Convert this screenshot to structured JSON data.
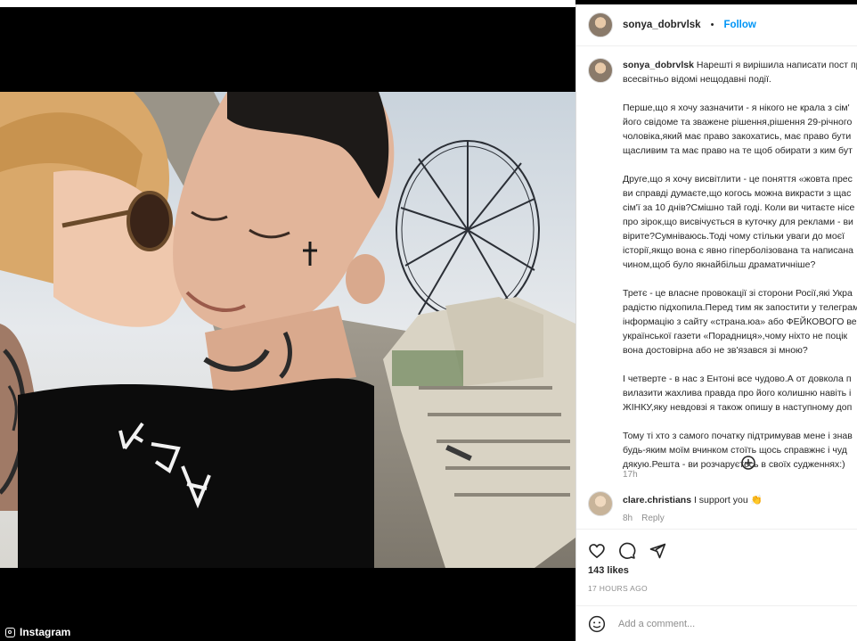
{
  "post": {
    "username": "sonya_dobrvlsk",
    "follow_label": "Follow",
    "caption_intro": "Нарешті я вирішила написати пост пр",
    "caption_lines": [
      "всесвітньо відомі нещодавні події.",
      "",
      "Перше,що я хочу зазначити - я нікого не крала з сім'",
      "його свідоме та зважене рішення,рішення 29-річного",
      "чоловіка,який має право закохатись, має право бути",
      "щасливим та має право на те щоб обирати з ким бут",
      "",
      "Друге,що я хочу висвітлити - це поняття «жовта прес",
      "ви справді думаєте,що когось можна викрасти з щас",
      "сім'ї за 10 днів?Смішно тай годі. Коли ви читаєте нісе",
      "про зірок,що висвічується в куточку для реклами - ви",
      "вірите?Сумніваюсь.Тоді чому стільки уваги до моєї",
      "історії,якщо вона є явно гіперболізована та написана",
      "чином,щоб було якнайбільш драматичніше?",
      "",
      "Третє - це власне провокації зі сторони Росії,які Укра",
      "радістю підхопила.Перед тим як запостити у телеграм",
      "інформацію з сайту «страна.юа» або ФЕЙКОВОГО ве",
      "української газети «Порадниця»,чому ніхто не поцік",
      "вона достовірна або не зв'язався зі мною?",
      "",
      "І четверте - в нас з Ентоні все чудово.А от довкола п",
      "вилазити жахлива правда про його колишню навіть і",
      "ЖІНКУ,яку невдовзі я також опишу в наступному доп",
      "",
      "Тому ті хто з самого початку підтримував мене і знав",
      "будь-яким моїм вчинком стоїть щось справжнє і чуд",
      "дякую.Решта - ви розчаруєтесь в своїх судженнях:)"
    ],
    "caption_time": "17h",
    "likes": "143 likes",
    "time_ago": "17 HOURS AGO",
    "add_comment_placeholder": "Add a comment..."
  },
  "comment": {
    "username": "clare.christians",
    "text": "I support you 👏",
    "time": "8h",
    "reply_label": "Reply"
  },
  "watermark": "Instagram",
  "icons": {
    "like": "heart-icon",
    "comment": "comment-icon",
    "share": "send-icon",
    "more_comments": "plus-circle-icon",
    "emoji": "emoji-icon"
  }
}
